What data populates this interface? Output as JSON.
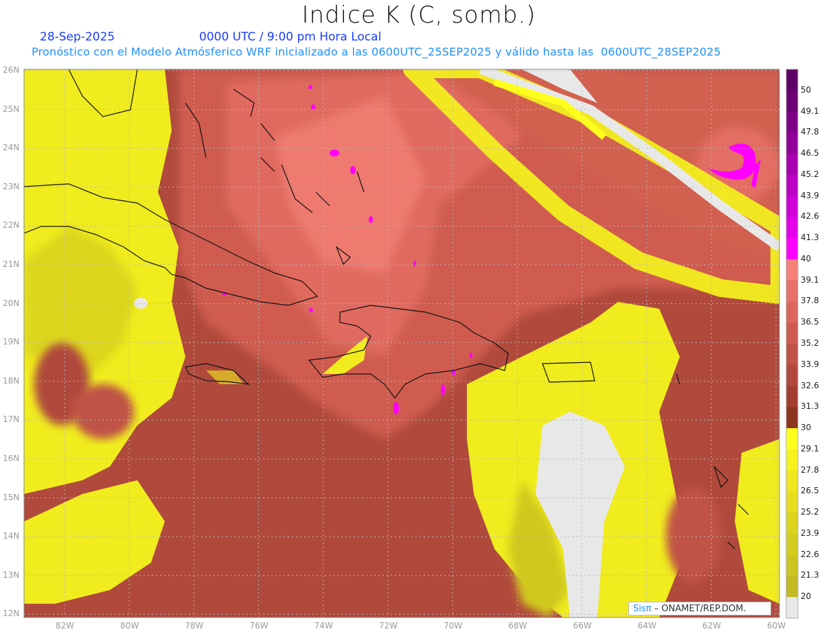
{
  "header": {
    "title": "Indice K (C, somb.)",
    "date": "28-Sep-2025",
    "time": "0000 UTC / 9:00 pm Hora Local",
    "description": "Pronóstico con el Modelo Atmósferico WRF inicializado a las 0600UTC_25SEP2025 y válido hasta las  0600UTC_28SEP2025"
  },
  "colorbar": {
    "labels": [
      "50",
      "49.1",
      "47.8",
      "46.5",
      "45.2",
      "43.9",
      "42.6",
      "41.3",
      "40",
      "39.1",
      "37.8",
      "36.5",
      "35.2",
      "33.9",
      "32.6",
      "31.3",
      "30",
      "29.1",
      "27.8",
      "26.5",
      "25.2",
      "23.9",
      "22.6",
      "21.3",
      "20"
    ],
    "colors": [
      "#5e0064",
      "#6c0074",
      "#7e0086",
      "#92009a",
      "#a800b0",
      "#bc00c4",
      "#d000d8",
      "#e400ea",
      "#ff00ff",
      "#f48078",
      "#e8706a",
      "#dc665c",
      "#cf5c50",
      "#c05246",
      "#b2483c",
      "#a23e30",
      "#8c3420",
      "#ffff1e",
      "#f6f21e",
      "#eee81e",
      "#e6de1c",
      "#dcd41c",
      "#d4cc1e",
      "#ccc420",
      "#c2ba22",
      "#e8e8e8"
    ]
  },
  "axes": {
    "lat_labels": [
      "26N",
      "25N",
      "24N",
      "23N",
      "22N",
      "21N",
      "20N",
      "19N",
      "18N",
      "17N",
      "16N",
      "15N",
      "14N",
      "13N",
      "12N"
    ],
    "lon_labels": [
      "82W",
      "80W",
      "78W",
      "76W",
      "74W",
      "72W",
      "70W",
      "68W",
      "66W",
      "64W",
      "62W",
      "60W"
    ]
  },
  "credit": {
    "logo": "Sisπ",
    "text": "– ONAMET/REP.DOM."
  }
}
